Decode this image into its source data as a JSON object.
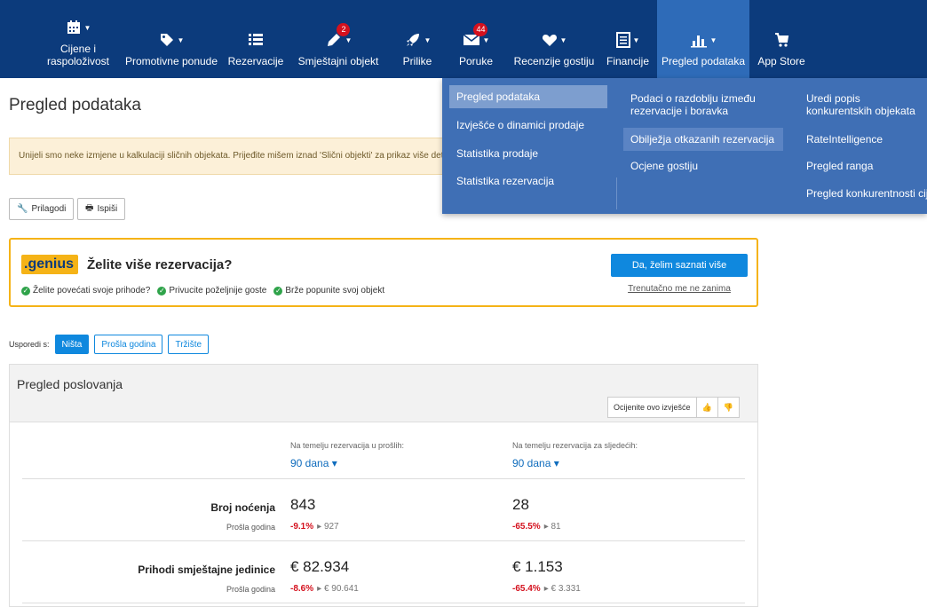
{
  "nav": [
    {
      "label": "Cijene i\nraspoloživost",
      "icon": "calendar-icon",
      "badge": ""
    },
    {
      "label": "Promotivne ponude",
      "icon": "tag-icon",
      "badge": ""
    },
    {
      "label": "Rezervacije",
      "icon": "list-icon",
      "badge": ""
    },
    {
      "label": "Smještajni objekt",
      "icon": "pencil-icon",
      "badge": "2"
    },
    {
      "label": "Prilike",
      "icon": "rocket-icon",
      "badge": ""
    },
    {
      "label": "Poruke",
      "icon": "envelope-icon",
      "badge": "44"
    },
    {
      "label": "Recenzije gostiju",
      "icon": "heart-icon",
      "badge": ""
    },
    {
      "label": "Financije",
      "icon": "document-icon",
      "badge": ""
    },
    {
      "label": "Pregled podataka",
      "icon": "bar-chart-icon",
      "badge": ""
    },
    {
      "label": "App Store",
      "icon": "cart-icon",
      "badge": ""
    }
  ],
  "dropdown": {
    "col1": [
      "Pregled podataka",
      "Izvješće o dinamici prodaje",
      "Statistika prodaje",
      "Statistika rezervacija"
    ],
    "col2": [
      "Podaci o razdoblju između rezervacije i boravka",
      "Obilježja otkazanih rezervacija",
      "Ocjene gostiju"
    ],
    "col3": [
      "Uredi popis konkurentskih objekata",
      "RateIntelligence",
      "Pregled ranga",
      "Pregled konkurentnosti cijena"
    ]
  },
  "page": {
    "title": "Pregled podataka",
    "notice": "Unijeli smo neke izmjene u kalkulaciji sličnih objekata. Prijeđite mišem iznad 'Slični objekti' za prikaz više detalja.",
    "customize": "Prilagodi",
    "print": "Ispiši"
  },
  "genius": {
    "logo": ".genius",
    "title": "Želite više rezervacija?",
    "points": [
      "Želite povećati svoje prihode?",
      "Privucite poželjnije goste",
      "Brže popunite svoj objekt"
    ],
    "cta": "Da, želim saznati više",
    "decline": "Trenutačno me ne zanima"
  },
  "compare": {
    "label": "Usporedi s:",
    "options": [
      "Ništa",
      "Prošla godina",
      "Tržište"
    ]
  },
  "report": {
    "title": "Pregled poslovanja",
    "rate_label": "Ocijenite ovo izvješće",
    "col1_head": "Na temelju rezervacija u prošlih:",
    "col1_days": "90 dana",
    "col2_head": "Na temelju rezervacija za sljedećih:",
    "col2_days": "90 dana",
    "rows": [
      {
        "label": "Broj noćenja",
        "sub": "Prošla godina",
        "v1": "843",
        "d1": "-9.1%",
        "p1": "927",
        "v2": "28",
        "d2": "-65.5%",
        "p2": "81"
      },
      {
        "label": "Prihodi smještajne jedinice",
        "sub": "Prošla godina",
        "v1": "€ 82.934",
        "d1": "-8.6%",
        "p1": "€ 90.641",
        "v2": "€ 1.153",
        "d2": "-65.4%",
        "p2": "€ 3.331"
      }
    ]
  }
}
